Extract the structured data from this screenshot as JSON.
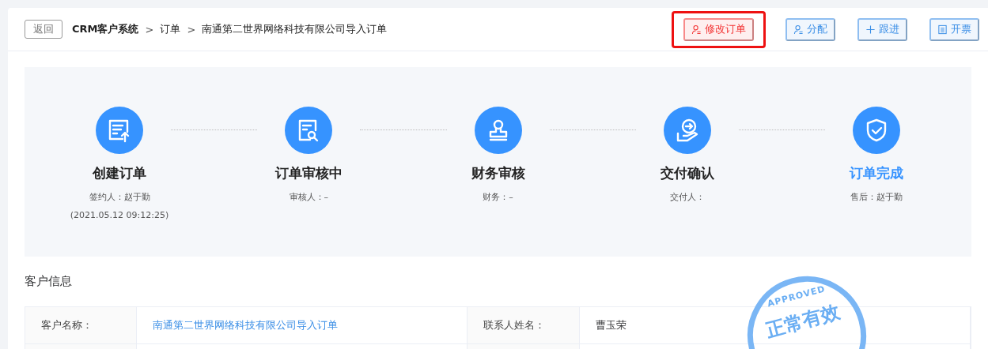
{
  "header": {
    "back_button": "返回",
    "breadcrumb": [
      "CRM客户系统",
      "订单",
      "南通第二世界网络科技有限公司导入订单"
    ],
    "separator": ">"
  },
  "actions": [
    {
      "label": "修改订单",
      "kind": "person",
      "color": "#f33333",
      "highlighted": true
    },
    {
      "label": "分配",
      "kind": "person",
      "color": "#3a8ee6",
      "highlighted": false
    },
    {
      "label": "跟进",
      "kind": "plus",
      "color": "#3a8ee6",
      "highlighted": false
    },
    {
      "label": "开票",
      "kind": "doc",
      "color": "#3a8ee6",
      "highlighted": false
    }
  ],
  "steps": [
    {
      "kind": "create",
      "title": "创建订单",
      "lines": [
        "签约人：赵于勤",
        "(2021.05.12 09:12:25)"
      ],
      "selected": false
    },
    {
      "kind": "review",
      "title": "订单审核中",
      "lines": [
        "审核人：–"
      ],
      "selected": false
    },
    {
      "kind": "finance",
      "title": "财务审核",
      "lines": [
        "财务：–"
      ],
      "selected": false
    },
    {
      "kind": "delivery",
      "title": "交付确认",
      "lines": [
        "交付人："
      ],
      "selected": false
    },
    {
      "kind": "done",
      "title": "订单完成",
      "lines": [
        "售后：赵于勤"
      ],
      "selected": true
    }
  ],
  "customer_info": {
    "title": "客户信息",
    "rows": [
      {
        "cells": [
          {
            "label": "客户名称：",
            "value": "南通第二世界网络科技有限公司导入订单",
            "link": true
          },
          {
            "label": "联系人姓名：",
            "value": "曹玉荣",
            "link": false
          }
        ]
      }
    ]
  },
  "stamp": {
    "top_text": "APPROVED",
    "text": "正常有效"
  }
}
